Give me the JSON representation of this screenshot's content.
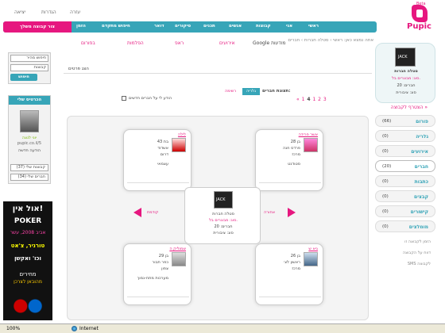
{
  "top": {
    "help": "עזרה",
    "settings": "הגדרות",
    "logout": "יציאה"
  },
  "logo": {
    "text": "Pupic",
    "tag": "Beta"
  },
  "nav": {
    "join_button": "צור קבוצה משלך",
    "items": [
      "ראשי",
      "אני",
      "קבוצות",
      "אנשים",
      "תכנים",
      "סיקורים",
      "דואר",
      "חיפוש מתקדם",
      "הזמן"
    ]
  },
  "subnav": {
    "google": "Google מודעות",
    "events": "אירועים",
    "rav": "ראפ",
    "prices": "הפלמות",
    "tabs": "בפורום"
  },
  "breadcrumb": "אתה נמצא כאן: ראשי › סטלה חברות › חברים",
  "search": {
    "placeholder": "חיפוש מהיר",
    "select": "קבוצות",
    "button": "חיפוש"
  },
  "friends": {
    "title": "הכרטיס שלי",
    "name": "יוני לנצה",
    "site": "pupic.co.il/5",
    "message": "הודעה חדשה",
    "select_groups": "קבוצות שלי (37)",
    "select_friends": "חברים שלי (34)"
  },
  "ad": {
    "line1": "אול אין!",
    "line2": "POKER",
    "line3": "אביב 2008, עשר",
    "line4": "טורניר, צ'אט",
    "line5": "וכו' ואקשן",
    "line6": "מחירים",
    "line7": "מהובאן לצרכן"
  },
  "main": {
    "show_members": "הצג פרטים",
    "view_label": "תצוגת חברים:",
    "view_gallery": "גלריה",
    "view_list": "רשימה",
    "notify": "הודע לי על חברים חדשים",
    "pager_prefix": "« 1",
    "pager_pages": "1 2 3",
    "pager_current": "4",
    "pager_rest": "5 6 7 »"
  },
  "cards": [
    {
      "name": "אשר פרידה",
      "l1": "בן 28",
      "l2": "פרדס חנה",
      "l3": "מרכז",
      "l4": "סטודנט"
    },
    {
      "name": "לילה",
      "l1": "בת 43",
      "l2": "אשדוד",
      "l3": "דרום",
      "l4": "עצמאי"
    },
    {
      "name": "גיא ש",
      "l1": "בן 26",
      "l2": "ראשון לצ׳",
      "l3": "מרכז",
      "l4": ""
    },
    {
      "name": "שמוליק ה",
      "l1": "בן 29",
      "l2": "כפר תבור",
      "l3": "צפון",
      "l4": "מערכות מתח-נמוך"
    }
  ],
  "center": {
    "name": "סטלה חברות",
    "type": "סוג: מבוגרים בל.",
    "members": "חברים: 20",
    "kind": "סוג: ציבורית"
  },
  "nav_arrows": {
    "prev": "קודמת",
    "next": "אחורה"
  },
  "group": {
    "name": "סטלה חברות",
    "type": "סוג: מבוגרים בל.",
    "members": "חברים: 20",
    "kind": "סוג: ציבורית"
  },
  "join": "הצטרף לקבוצה »",
  "right_tabs": [
    {
      "label": "פורום",
      "count": "(66)"
    },
    {
      "label": "גלריה",
      "count": "(0)"
    },
    {
      "label": "אירועים",
      "count": "(0)"
    },
    {
      "label": "חברים",
      "count": "(20)"
    },
    {
      "label": "כתבות",
      "count": "(0)"
    },
    {
      "label": "קבצים",
      "count": "(0)"
    },
    {
      "label": "קישורים",
      "count": "(0)"
    },
    {
      "label": "מומלצים",
      "count": "(0)"
    }
  ],
  "right_links": [
    "הזמן לקבוצה זו",
    "דווח על הקבוצה",
    "SMS לקבוצה"
  ],
  "status": {
    "zoom": "100%",
    "zone": "Internet"
  },
  "colors": {
    "accent": "#e6177f",
    "teal": "#37a5b8"
  }
}
